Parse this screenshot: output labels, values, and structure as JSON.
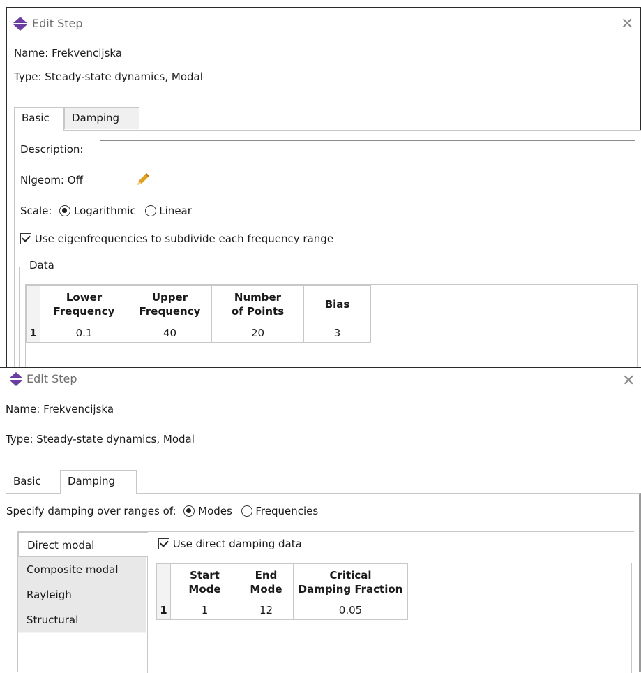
{
  "dialogs": [
    {
      "title": "Edit Step",
      "name_label": "Name:",
      "name_value": "Frekvencijska",
      "type_label": "Type:",
      "type_value": "Steady-state dynamics, Modal",
      "tabs": [
        {
          "label": "Basic",
          "active": true
        },
        {
          "label": "Damping",
          "active": false
        }
      ],
      "basic": {
        "description_label": "Description:",
        "description_value": "",
        "nlgeom_label": "Nlgeom:",
        "nlgeom_value": "Off",
        "scale_label": "Scale:",
        "scale_options": [
          {
            "label": "Logarithmic",
            "selected": true
          },
          {
            "label": "Linear",
            "selected": false
          }
        ],
        "eigen_checkbox_label": "Use eigenfrequencies to subdivide each frequency range",
        "eigen_checked": true,
        "data_group_label": "Data",
        "table": {
          "headers": [
            [
              "Lower",
              "Frequency"
            ],
            [
              "Upper",
              "Frequency"
            ],
            [
              "Number",
              "of Points"
            ],
            [
              "Bias"
            ]
          ],
          "rows": [
            {
              "index": "1",
              "cells": [
                "0.1",
                "40",
                "20",
                "3"
              ]
            }
          ]
        }
      }
    },
    {
      "title": "Edit Step",
      "name_label": "Name:",
      "name_value": "Frekvencijska",
      "type_label": "Type:",
      "type_value": "Steady-state dynamics, Modal",
      "tabs": [
        {
          "label": "Basic",
          "active": false
        },
        {
          "label": "Damping",
          "active": true
        }
      ],
      "damping": {
        "specify_label": "Specify damping over ranges of:",
        "range_options": [
          {
            "label": "Modes",
            "selected": true
          },
          {
            "label": "Frequencies",
            "selected": false
          }
        ],
        "side_tabs": [
          "Direct modal",
          "Composite modal",
          "Rayleigh",
          "Structural"
        ],
        "active_side_tab": "Direct modal",
        "use_direct_label": "Use direct damping data",
        "use_direct_checked": true,
        "table": {
          "headers": [
            [
              "Start",
              "Mode"
            ],
            [
              "End",
              "Mode"
            ],
            [
              "Critical",
              "Damping Fraction"
            ]
          ],
          "rows": [
            {
              "index": "1",
              "cells": [
                "1",
                "12",
                "0.05"
              ]
            }
          ]
        }
      }
    }
  ],
  "colors": {
    "icon_purple": "#6b3fa0",
    "border": "#c8c8c8",
    "pencil": "#e0a020"
  },
  "icons": {
    "app": "abaqus-diamond-icon",
    "close": "close-icon",
    "edit": "pencil-icon"
  }
}
